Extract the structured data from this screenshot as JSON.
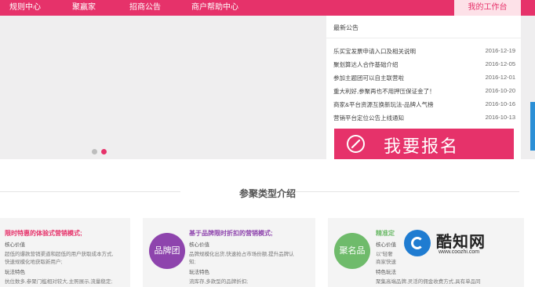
{
  "nav": {
    "items": [
      "规则中心",
      "聚赢家",
      "招商公告",
      "商户帮助中心"
    ],
    "workbench": "我的工作台"
  },
  "notice": {
    "title": "最新公告",
    "items": [
      {
        "title": "乐买宝发票申请入口及相关说明",
        "date": "2016-12-19"
      },
      {
        "title": "聚划算达人合作基础介绍",
        "date": "2016-12-05"
      },
      {
        "title": "参加主题团可以自主联营啦",
        "date": "2016-12-01"
      },
      {
        "title": "重大利好,参聚再也不用押压保证金了！",
        "date": "2016-10-20"
      },
      {
        "title": "商家&平台资源互换新玩法-品牌人气榜",
        "date": "2016-10-16"
      },
      {
        "title": "营销平台定位公告上线通知",
        "date": "2016-10-13"
      }
    ]
  },
  "signup": {
    "label": "我要报名"
  },
  "section": {
    "title": "参聚类型介绍"
  },
  "cards": [
    {
      "title": "限时特惠的体验式营销模式;",
      "core_label": "核心价值",
      "core_text": "超低的爆款营销渠道和超低的用户获取成本方式,",
      "core_text2": "快速规模化地获取新用户;",
      "play_label": "玩法特色",
      "play_text": "抗位数多,参聚门槛相对较大,主照展示,流量稳定;"
    },
    {
      "title": "基于品牌限时折扣的营销模式;",
      "badge": "品牌团",
      "core_label": "核心价值",
      "core_text": "品牌规模化出货,快速抢占市场份额,提升品牌认",
      "core_text2": "知;",
      "play_label": "玩法特色",
      "play_text": "流库存,多款型的品牌折扣;"
    },
    {
      "title": "精准定",
      "badge": "聚名品",
      "core_label": "核心价值",
      "core_text": "以“轻奢",
      "core_text2": "商家快速",
      "play_label": "特色玩法",
      "play_text": "聚集高端品牌,灵活的佣金收费方式,具有单品同"
    }
  ],
  "watermark": {
    "name": "酷知网",
    "url": "www.coozhi.com"
  },
  "colors": {
    "accent": "#e6326a",
    "purple": "#8e44ad",
    "green": "#6fbb6b",
    "blue": "#1f7cd1"
  }
}
